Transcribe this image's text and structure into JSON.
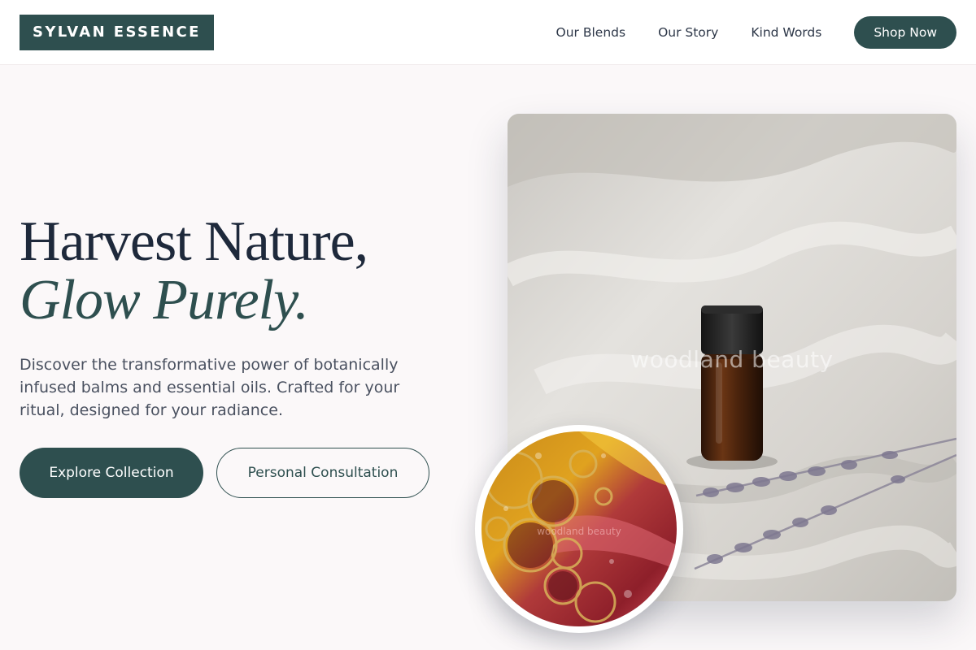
{
  "header": {
    "logo_text": "SYLVAN ESSENCE",
    "nav": [
      "Our Blends",
      "Our Story",
      "Kind Words"
    ],
    "cta_label": "Shop Now"
  },
  "hero": {
    "title_line1": "Harvest Nature,",
    "title_line2": "Glow Purely.",
    "subtitle": "Discover the transformative power of botanically infused balms and essential oils. Crafted for your ritual, designed for your radiance.",
    "primary_button": "Explore Collection",
    "secondary_button": "Personal Consultation"
  },
  "images": {
    "main_watermark": "woodland beauty",
    "small_watermark": "woodland beauty"
  },
  "colors": {
    "brand": "#2e4f4f",
    "background": "#fbf8f9",
    "heading": "#1e293b"
  }
}
